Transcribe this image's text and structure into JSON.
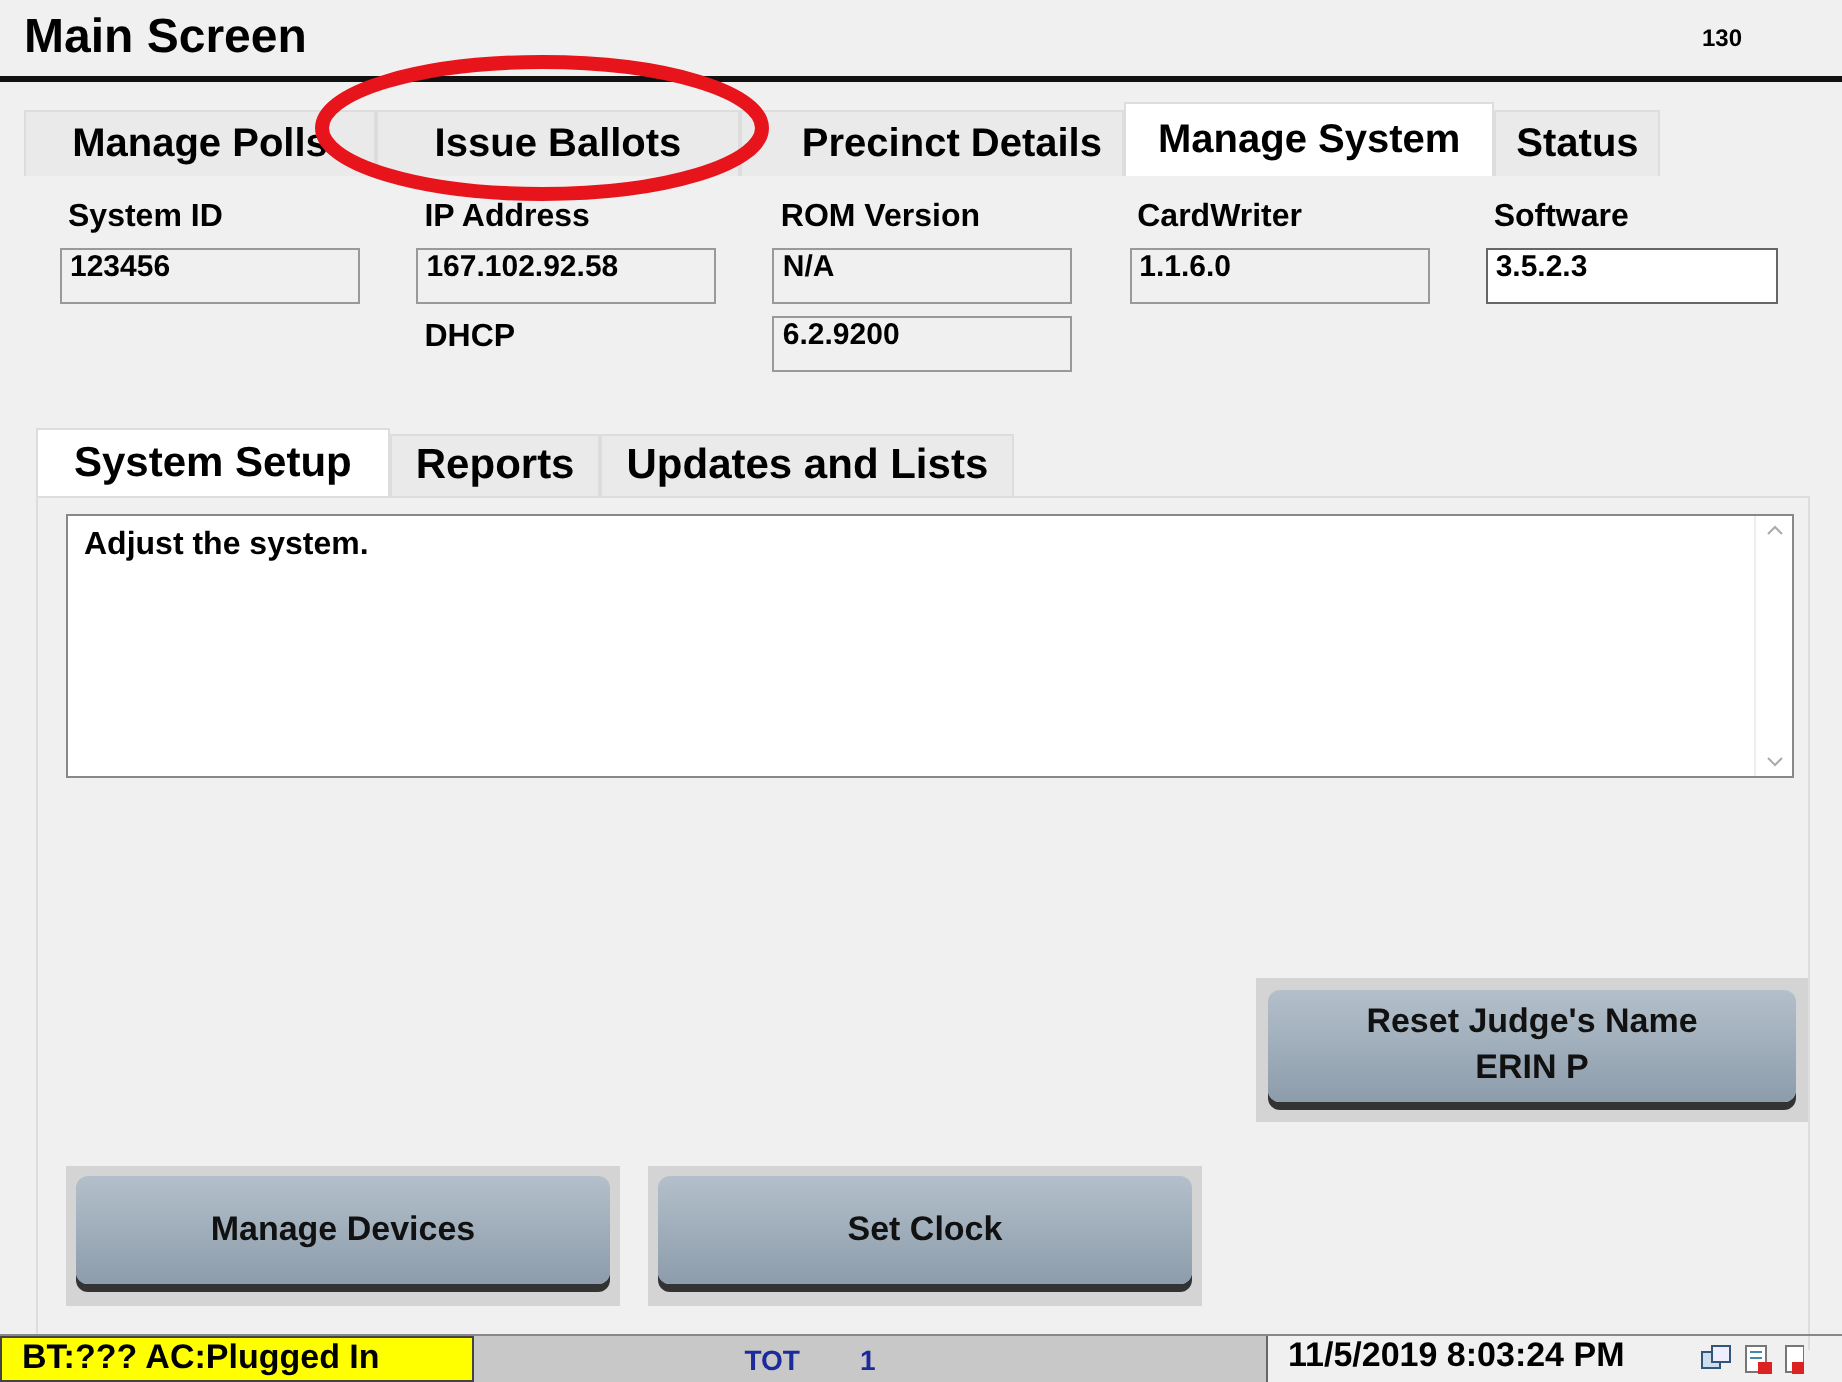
{
  "window": {
    "title": "Main Screen",
    "number": "130"
  },
  "tabs": [
    {
      "label": "Manage Polls",
      "selected": false
    },
    {
      "label": "Issue Ballots",
      "selected": false
    },
    {
      "label": "Precinct Details",
      "selected": false
    },
    {
      "label": "Manage System",
      "selected": true
    },
    {
      "label": "Status",
      "selected": false
    }
  ],
  "info": [
    {
      "label": "System ID",
      "value": "123456",
      "editable": false
    },
    {
      "label": "IP Address",
      "value": "167.102.92.58",
      "editable": false,
      "extra": {
        "kind": "label",
        "text": "DHCP"
      }
    },
    {
      "label": "ROM Version",
      "value": "N/A",
      "editable": false,
      "extra": {
        "kind": "field",
        "text": "6.2.9200"
      }
    },
    {
      "label": "CardWriter",
      "value": "1.1.6.0",
      "editable": false
    },
    {
      "label": "Software",
      "value": "3.5.2.3",
      "editable": true
    }
  ],
  "subtabs": [
    {
      "label": "System Setup",
      "selected": true
    },
    {
      "label": "Reports",
      "selected": false
    },
    {
      "label": "Updates and Lists",
      "selected": false
    }
  ],
  "description": "Adjust the system.",
  "judge_button": [
    "Reset Judge's Name",
    "ERIN P"
  ],
  "buttons": [
    "Manage Devices",
    "Set Clock"
  ],
  "status_bar": {
    "power": "BT:??? AC:Plugged In",
    "tot_label": "TOT",
    "tot_value": "1",
    "datetime": "11/5/2019 8:03:24 PM"
  },
  "annotation": {
    "kind": "ellipse",
    "color": "#e8141b"
  }
}
